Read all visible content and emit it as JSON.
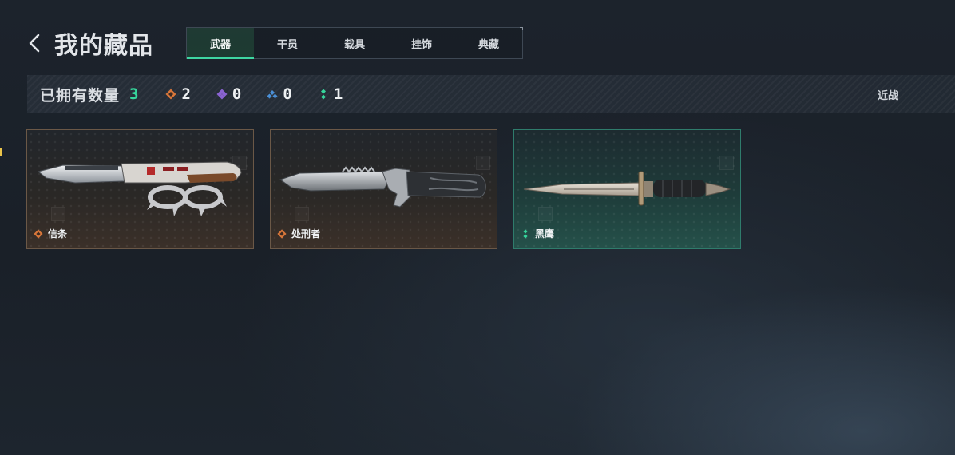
{
  "header": {
    "title": "我的藏品",
    "back_icon": "chevron-left-icon"
  },
  "tabs": [
    {
      "label": "武器",
      "active": true
    },
    {
      "label": "干员",
      "active": false
    },
    {
      "label": "载具",
      "active": false
    },
    {
      "label": "挂饰",
      "active": false
    },
    {
      "label": "典藏",
      "active": false
    }
  ],
  "stats": {
    "owned_label": "已拥有数量",
    "owned_count": "3",
    "rarities": [
      {
        "icon": "orange-diamond-icon",
        "color": "#d9773a",
        "count": "2"
      },
      {
        "icon": "purple-diamond-icon",
        "color": "#8a63d2",
        "count": "0"
      },
      {
        "icon": "blue-diamond-icon",
        "color": "#4a8fd6",
        "count": "0"
      },
      {
        "icon": "green-diamond-icon",
        "color": "#36d69c",
        "count": "1"
      }
    ],
    "filter_label": "近战"
  },
  "items": [
    {
      "name": "信条",
      "rarity": "orange",
      "rarity_color": "#d9773a",
      "image": "knuckle-knife-image"
    },
    {
      "name": "处刑者",
      "rarity": "orange",
      "rarity_color": "#d9773a",
      "image": "serrated-knife-image"
    },
    {
      "name": "黑鹰",
      "rarity": "green",
      "rarity_color": "#36d69c",
      "image": "dagger-image"
    }
  ],
  "colors": {
    "accent": "#36d69c",
    "orange": "#d9773a",
    "active_tab_bg": "#1f3a33"
  }
}
